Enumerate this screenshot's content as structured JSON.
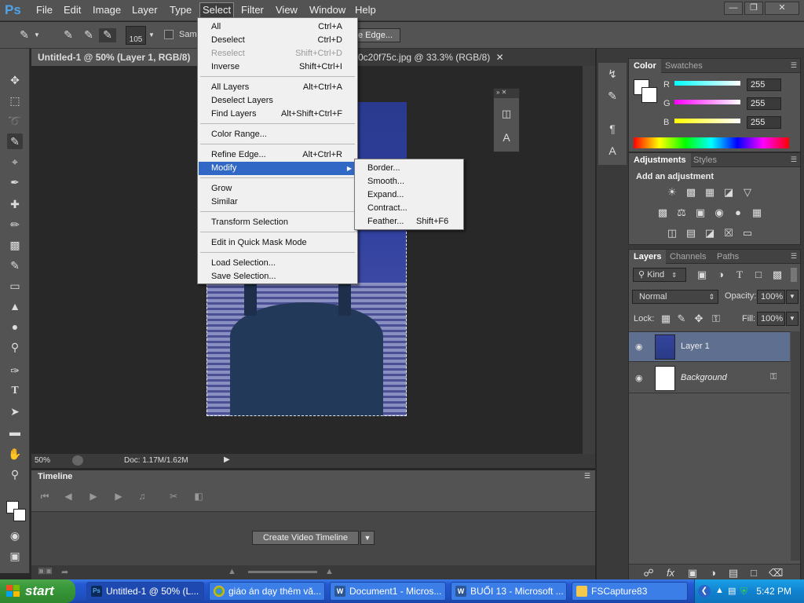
{
  "app": {
    "logo_text": "Ps"
  },
  "menubar": {
    "items": [
      "File",
      "Edit",
      "Image",
      "Layer",
      "Type",
      "Select",
      "Filter",
      "View",
      "Window",
      "Help"
    ],
    "active": "Select"
  },
  "options_bar": {
    "brush_size": "105",
    "sample_label": "Samp",
    "refine_edge_label": "e Edge..."
  },
  "doc_tabs": [
    {
      "label": "Untitled-1 @ 50% (Layer 1, RGB/8)",
      "active": true
    },
    {
      "label": "0c20f75c.jpg @ 33.3% (RGB/8)",
      "active": false
    }
  ],
  "status_bar": {
    "zoom": "50%",
    "doc_info": "Doc: 1.17M/1.62M"
  },
  "timeline": {
    "title": "Timeline",
    "create_button": "Create Video Timeline"
  },
  "select_menu": {
    "items": [
      {
        "label": "All",
        "shortcut": "Ctrl+A"
      },
      {
        "label": "Deselect",
        "shortcut": "Ctrl+D"
      },
      {
        "label": "Reselect",
        "shortcut": "Shift+Ctrl+D",
        "disabled": true
      },
      {
        "label": "Inverse",
        "shortcut": "Shift+Ctrl+I"
      },
      {
        "label": "All Layers",
        "shortcut": "Alt+Ctrl+A"
      },
      {
        "label": "Deselect Layers",
        "shortcut": ""
      },
      {
        "label": "Find Layers",
        "shortcut": "Alt+Shift+Ctrl+F"
      },
      {
        "label": "Color Range...",
        "shortcut": ""
      },
      {
        "label": "Refine Edge...",
        "shortcut": "Alt+Ctrl+R"
      },
      {
        "label": "Modify",
        "shortcut": "",
        "highlighted": true
      },
      {
        "label": "Grow",
        "shortcut": ""
      },
      {
        "label": "Similar",
        "shortcut": ""
      },
      {
        "label": "Transform Selection",
        "shortcut": ""
      },
      {
        "label": "Edit in Quick Mask Mode",
        "shortcut": ""
      },
      {
        "label": "Load Selection...",
        "shortcut": ""
      },
      {
        "label": "Save Selection...",
        "shortcut": ""
      }
    ]
  },
  "modify_menu": {
    "items": [
      {
        "label": "Border...",
        "shortcut": ""
      },
      {
        "label": "Smooth...",
        "shortcut": ""
      },
      {
        "label": "Expand...",
        "shortcut": ""
      },
      {
        "label": "Contract...",
        "shortcut": ""
      },
      {
        "label": "Feather...",
        "shortcut": "Shift+F6"
      }
    ]
  },
  "color_panel": {
    "tabs": [
      "Color",
      "Swatches"
    ],
    "channels": [
      {
        "name": "R",
        "value": "255",
        "color": "#ff0000"
      },
      {
        "name": "G",
        "value": "255",
        "color": "#00ff00"
      },
      {
        "name": "B",
        "value": "255",
        "color": "#0000ff"
      }
    ]
  },
  "adjustments_panel": {
    "tabs": [
      "Adjustments",
      "Styles"
    ],
    "heading": "Add an adjustment"
  },
  "layers_panel": {
    "tabs": [
      "Layers",
      "Channels",
      "Paths"
    ],
    "filter_kind": "Kind",
    "blend_mode": "Normal",
    "opacity_label": "Opacity:",
    "opacity_value": "100%",
    "lock_label": "Lock:",
    "fill_label": "Fill:",
    "fill_value": "100%",
    "layers": [
      {
        "name": "Layer 1",
        "selected": true
      },
      {
        "name": "Background",
        "selected": false,
        "locked": true
      }
    ]
  },
  "taskbar": {
    "start_label": "start",
    "tasks": [
      {
        "label": "Untitled-1 @ 50% (L...",
        "active": true
      },
      {
        "label": "giáo án dạy thêm vă...",
        "active": false
      },
      {
        "label": "Document1 - Micros...",
        "active": false
      },
      {
        "label": "BUỔI 13 - Microsoft ...",
        "active": false
      },
      {
        "label": "FSCapture83",
        "active": false
      }
    ],
    "clock": "5:42 PM"
  }
}
